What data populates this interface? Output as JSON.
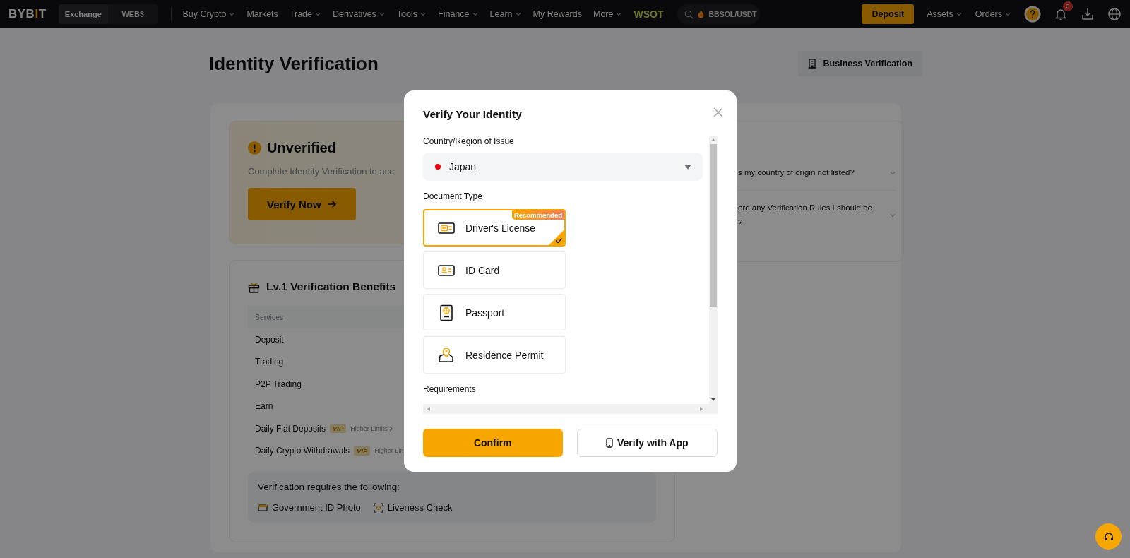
{
  "nav": {
    "logo": "BYBIT",
    "switch": [
      {
        "label": "Exchange",
        "selected": true
      },
      {
        "label": "WEB3",
        "selected": false
      }
    ],
    "menu": [
      {
        "label": "Buy Crypto",
        "dropdown": true,
        "kind": "link"
      },
      {
        "label": "Markets",
        "dropdown": false,
        "kind": "link"
      },
      {
        "label": "Trade",
        "dropdown": true,
        "kind": "link"
      },
      {
        "label": "Derivatives",
        "dropdown": true,
        "kind": "link"
      },
      {
        "label": "Tools",
        "dropdown": true,
        "kind": "link"
      },
      {
        "label": "Finance",
        "dropdown": true,
        "kind": "link"
      },
      {
        "label": "Learn",
        "dropdown": true,
        "kind": "link"
      },
      {
        "label": "My Rewards",
        "dropdown": false,
        "kind": "link"
      },
      {
        "label": "More",
        "dropdown": true,
        "kind": "link"
      },
      {
        "label": "WSOT",
        "dropdown": false,
        "kind": "promo"
      }
    ],
    "search": {
      "placeholder": "BBSOL/USDT"
    },
    "deposit": "Deposit",
    "right_menu": [
      {
        "label": "Assets",
        "dropdown": true
      },
      {
        "label": "Orders",
        "dropdown": true
      }
    ],
    "notifications": "3"
  },
  "page": {
    "title": "Identity Verification",
    "business_button": "Business Verification",
    "status": {
      "title": "Unverified",
      "description": "Complete Identity Verification to acc",
      "button": "Verify Now"
    },
    "benefits": {
      "title": "Lv.1 Verification Benefits",
      "columns": [
        "Services"
      ],
      "rows": [
        {
          "service": "Deposit"
        },
        {
          "service": "Trading"
        },
        {
          "service": "P2P Trading"
        },
        {
          "service": "Earn"
        },
        {
          "service": "Daily Fiat Deposits",
          "badge": "VIP",
          "note": "Higher Limits",
          "arrow": true
        },
        {
          "service": "Daily Crypto Withdrawals",
          "badge": "VIP",
          "note": "Higher Lim",
          "arrow": false
        }
      ]
    },
    "requirements": {
      "title": "Verification requires the following:",
      "items": [
        {
          "label": "Government ID Photo",
          "kind": "id"
        },
        {
          "label": "Liveness Check",
          "kind": "face"
        }
      ]
    },
    "faq": [
      {
        "lines": [
          "s my country of origin not listed?"
        ]
      },
      {
        "lines": [
          "ere any Verification Rules I should be",
          "?"
        ]
      }
    ]
  },
  "modal": {
    "title": "Verify Your Identity",
    "country_label": "Country/Region of Issue",
    "country": "Japan",
    "document_label": "Document Type",
    "document_types": [
      {
        "label": "Driver's License",
        "kind": "license",
        "selected": true,
        "badge": "Recommended"
      },
      {
        "label": "ID Card",
        "kind": "id",
        "selected": false
      },
      {
        "label": "Passport",
        "kind": "passport",
        "selected": false
      },
      {
        "label": "Residence Permit",
        "kind": "residence",
        "selected": false
      }
    ],
    "requirements_label": "Requirements",
    "confirm": "Confirm",
    "verify_app": "Verify with App"
  }
}
